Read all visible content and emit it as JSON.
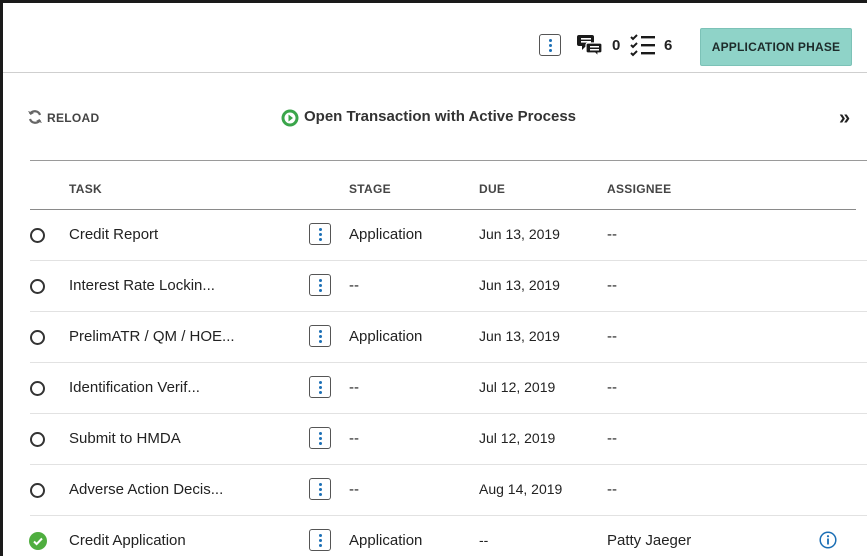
{
  "header": {
    "comments_count": "0",
    "tasks_count": "6",
    "phase_button": "APPLICATION PHASE"
  },
  "toolbar": {
    "reload_label": "RELOAD",
    "process_label": "Open Transaction with Active Process",
    "expand_glyph": "»"
  },
  "table": {
    "columns": {
      "task": "TASK",
      "stage": "STAGE",
      "due": "DUE",
      "assignee": "ASSIGNEE"
    },
    "rows": [
      {
        "task": "Credit Report",
        "stage": "Application",
        "due": "Jun 13, 2019",
        "assignee": "--",
        "done": false
      },
      {
        "task": "Interest Rate Lockin...",
        "stage": "--",
        "due": "Jun 13, 2019",
        "assignee": "--",
        "done": false
      },
      {
        "task": "PrelimATR / QM / HOE...",
        "stage": "Application",
        "due": "Jun 13, 2019",
        "assignee": "--",
        "done": false
      },
      {
        "task": "Identification Verif...",
        "stage": "--",
        "due": "Jul 12, 2019",
        "assignee": "--",
        "done": false
      },
      {
        "task": "Submit to HMDA",
        "stage": "--",
        "due": "Jul 12, 2019",
        "assignee": "--",
        "done": false
      },
      {
        "task": "Adverse Action Decis...",
        "stage": "--",
        "due": "Aug 14, 2019",
        "assignee": "--",
        "done": false
      },
      {
        "task": "Credit Application",
        "stage": "Application",
        "due": "--",
        "assignee": "Patty Jaeger",
        "done": true
      }
    ]
  },
  "colors": {
    "phase_button_bg": "#8fd3c8",
    "accent_blue": "#1c6fb5",
    "process_green": "#3aa54a",
    "done_green": "#4fae3f"
  }
}
